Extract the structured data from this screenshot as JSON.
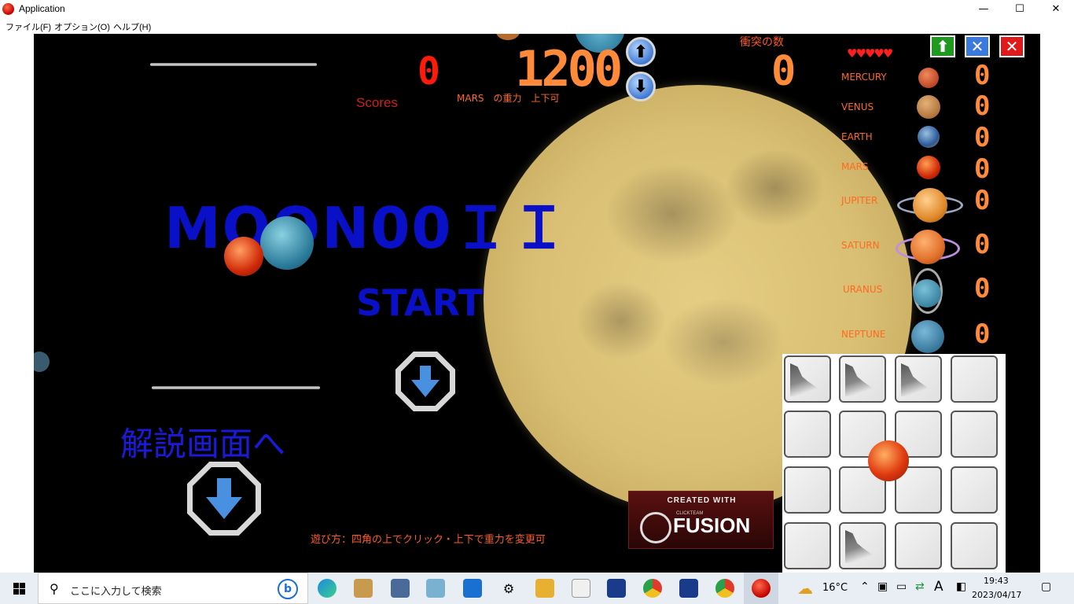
{
  "window": {
    "title": "Application",
    "minimize": "—",
    "maximize": "☐",
    "close": "✕"
  },
  "menu": {
    "items": [
      {
        "label": "ファイル(F)"
      },
      {
        "label": "オプション(O)"
      },
      {
        "label": "ヘルプ(H)"
      }
    ]
  },
  "hud": {
    "score_value": "0",
    "scores_label": "Scores",
    "time_value": "1200",
    "gravity_note": "MARS　の重力　上下可",
    "collision_label": "衝突の数",
    "collision_value": "0",
    "hearts": "♥♥♥♥♥",
    "up_arrow": "⬆",
    "down_arrow": "⬇"
  },
  "corner_buttons": {
    "up": "⬆",
    "minimize": "✕",
    "close": "✕"
  },
  "planets": [
    {
      "name": "MERCURY",
      "count": "0"
    },
    {
      "name": "VENUS",
      "count": "0"
    },
    {
      "name": "EARTH",
      "count": "0"
    },
    {
      "name": "MARS",
      "count": "0"
    },
    {
      "name": "JUPITER",
      "count": "0"
    },
    {
      "name": "SATURN",
      "count": "0"
    },
    {
      "name": "URANUS",
      "count": "0"
    },
    {
      "name": "NEPTUNE",
      "count": "0"
    }
  ],
  "screen": {
    "title": "MOON00ＩＩ",
    "start_label": "START",
    "howto_label": "解説画面へ",
    "instructions": "遊び方：四角の上でクリック・上下で重力を変更可"
  },
  "badge": {
    "top": "CREATED WITH",
    "small": "CLICKTEAM",
    "main": "FUSION"
  },
  "colors": {
    "title_blue": "#0a10c8",
    "hud_orange": "#ff8a3a",
    "score_red": "#ff1a0a"
  },
  "taskbar": {
    "search_placeholder": "ここに入力して検索",
    "bing": "b",
    "weather_temp": "16°C",
    "ime": "A",
    "time": "19:43",
    "date": "2023/04/17"
  }
}
